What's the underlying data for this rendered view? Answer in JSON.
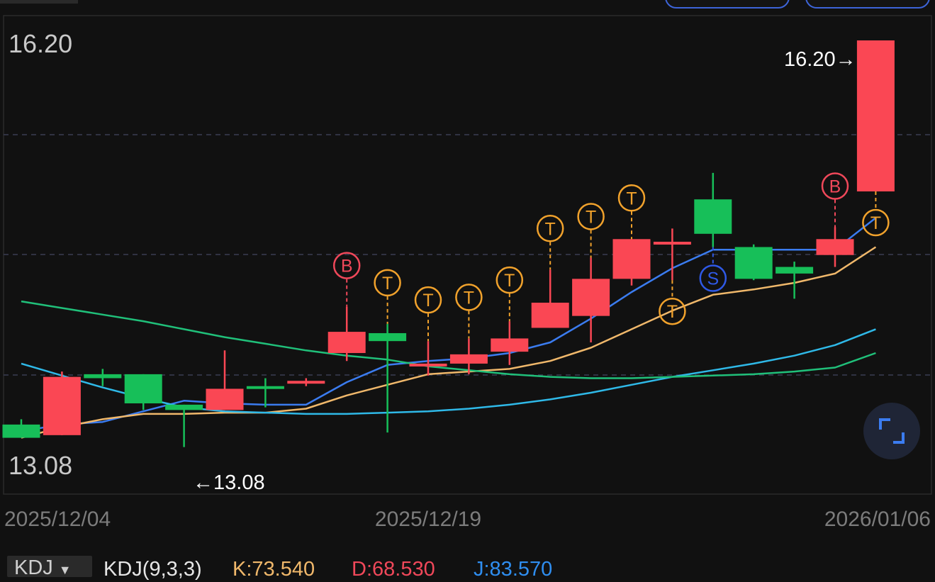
{
  "chart_data": {
    "type": "candlestick",
    "y_axis": {
      "ylim": [
        13.08,
        16.2
      ],
      "top_label": "16.20",
      "bottom_label": "13.08"
    },
    "x_tick_labels": [
      {
        "label": "2025/12/04",
        "index": 0
      },
      {
        "label": "2025/12/19",
        "index": 10
      },
      {
        "label": "2026/01/06",
        "index": 21
      }
    ],
    "max_annotation": {
      "text": "16.20→",
      "value": 16.2,
      "index": 21
    },
    "min_annotation": {
      "text": "←13.08",
      "value": 13.08,
      "index": 4
    },
    "candles": [
      {
        "open": 13.3,
        "close": 13.2,
        "high": 13.34,
        "low": 13.2
      },
      {
        "open": 13.22,
        "close": 13.66,
        "high": 13.7,
        "low": 13.22
      },
      {
        "open": 13.68,
        "close": 13.65,
        "high": 13.72,
        "low": 13.59
      },
      {
        "open": 13.68,
        "close": 13.46,
        "high": 13.68,
        "low": 13.41
      },
      {
        "open": 13.45,
        "close": 13.41,
        "high": 13.45,
        "low": 13.13
      },
      {
        "open": 13.41,
        "close": 13.57,
        "high": 13.86,
        "low": 13.41
      },
      {
        "open": 13.59,
        "close": 13.57,
        "high": 13.65,
        "low": 13.43
      },
      {
        "open": 13.61,
        "close": 13.63,
        "high": 13.65,
        "low": 13.59
      },
      {
        "open": 13.84,
        "close": 14.0,
        "high": 14.19,
        "low": 13.78
      },
      {
        "open": 13.99,
        "close": 13.93,
        "high": 14.06,
        "low": 13.24
      },
      {
        "open": 13.74,
        "close": 13.76,
        "high": 13.93,
        "low": 13.67
      },
      {
        "open": 13.76,
        "close": 13.83,
        "high": 13.95,
        "low": 13.68
      },
      {
        "open": 13.85,
        "close": 13.95,
        "high": 14.08,
        "low": 13.75
      },
      {
        "open": 14.03,
        "close": 14.22,
        "high": 14.47,
        "low": 14.03
      },
      {
        "open": 14.12,
        "close": 14.4,
        "high": 14.56,
        "low": 13.92
      },
      {
        "open": 14.4,
        "close": 14.7,
        "high": 14.7,
        "low": 14.35
      },
      {
        "open": 14.66,
        "close": 14.68,
        "high": 14.78,
        "low": 14.39
      },
      {
        "open": 15.0,
        "close": 14.74,
        "high": 15.2,
        "low": 14.64
      },
      {
        "open": 14.64,
        "close": 14.4,
        "high": 14.66,
        "low": 14.39
      },
      {
        "open": 14.49,
        "close": 14.44,
        "high": 14.53,
        "low": 14.25
      },
      {
        "open": 14.58,
        "close": 14.7,
        "high": 14.79,
        "low": 14.49
      },
      {
        "open": 15.06,
        "close": 16.2,
        "high": 16.2,
        "low": 15.06
      }
    ],
    "series": [
      {
        "color": "#3b7cf0",
        "values": [
          13.25,
          13.3,
          13.32,
          13.4,
          13.48,
          13.46,
          13.45,
          13.45,
          13.62,
          13.75,
          13.78,
          13.8,
          13.84,
          13.92,
          14.1,
          14.3,
          14.48,
          14.62,
          14.62,
          14.62,
          14.62,
          14.86
        ]
      },
      {
        "color": "#f0b86b",
        "values": [
          13.2,
          13.28,
          13.34,
          13.38,
          13.38,
          13.39,
          13.39,
          13.42,
          13.52,
          13.6,
          13.68,
          13.7,
          13.72,
          13.78,
          13.88,
          14.02,
          14.16,
          14.28,
          14.32,
          14.37,
          14.44,
          14.64
        ]
      },
      {
        "color": "#2fb9e8",
        "values": [
          13.76,
          13.67,
          13.58,
          13.5,
          13.43,
          13.4,
          13.39,
          13.38,
          13.38,
          13.39,
          13.4,
          13.42,
          13.45,
          13.49,
          13.54,
          13.6,
          13.66,
          13.71,
          13.76,
          13.82,
          13.9,
          14.02
        ]
      },
      {
        "color": "#20c07a",
        "values": [
          14.23,
          14.18,
          14.13,
          14.08,
          14.02,
          13.96,
          13.91,
          13.86,
          13.82,
          13.79,
          13.74,
          13.71,
          13.68,
          13.66,
          13.65,
          13.65,
          13.66,
          13.67,
          13.68,
          13.7,
          13.73,
          13.84
        ]
      }
    ],
    "signals": [
      {
        "index": 8,
        "type": "B",
        "position": "above"
      },
      {
        "index": 9,
        "type": "T",
        "position": "above"
      },
      {
        "index": 10,
        "type": "T",
        "position": "above"
      },
      {
        "index": 11,
        "type": "T",
        "position": "above"
      },
      {
        "index": 12,
        "type": "T",
        "position": "above"
      },
      {
        "index": 13,
        "type": "T",
        "position": "above"
      },
      {
        "index": 14,
        "type": "T",
        "position": "above"
      },
      {
        "index": 15,
        "type": "T",
        "position": "above"
      },
      {
        "index": 16,
        "type": "T",
        "position": "below"
      },
      {
        "index": 17,
        "type": "S",
        "position": "below"
      },
      {
        "index": 20,
        "type": "B",
        "position": "above"
      },
      {
        "index": 21,
        "type": "T",
        "position": "below"
      }
    ],
    "colors": {
      "up": "#fa4754",
      "down": "#17bf59",
      "B": "#f0485a",
      "T": "#f1a22c",
      "S": "#2f59e6",
      "grid": "#3a3d52"
    }
  },
  "indicator": {
    "selector_label": "KDJ",
    "name": "KDJ(9,3,3)",
    "k_text": "K:73.540",
    "d_text": "D:68.530",
    "j_text": "J:83.570",
    "colors": {
      "name": "#e6e6e6",
      "k": "#f0b86b",
      "d": "#f0485a",
      "j": "#2f8ef0"
    }
  }
}
